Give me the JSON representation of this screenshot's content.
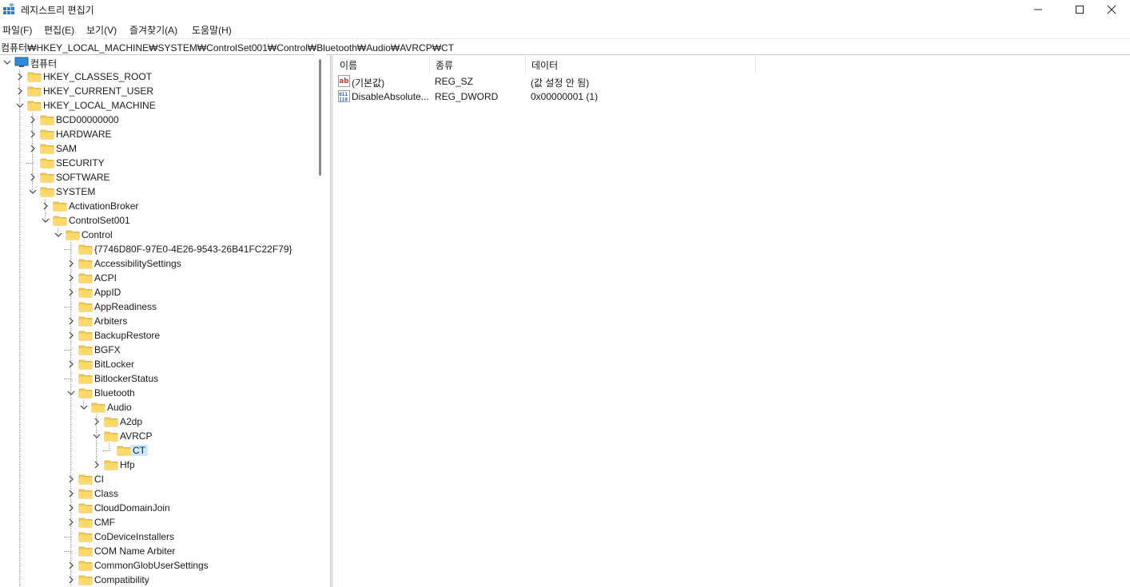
{
  "window": {
    "title": "레지스트리 편집기",
    "icon": "regedit-icon"
  },
  "menu": {
    "file": "파일(F)",
    "edit": "편집(E)",
    "view": "보기(V)",
    "favorites": "즐겨찾기(A)",
    "help": "도움말(H)"
  },
  "address": {
    "path": "컴퓨터₩HKEY_LOCAL_MACHINE₩SYSTEM₩ControlSet001₩Control₩Bluetooth₩Audio₩AVRCP₩CT"
  },
  "tree": {
    "nodes": [
      {
        "label": "컴퓨터",
        "level": 0,
        "state": "expanded",
        "icon": "computer-icon"
      },
      {
        "label": "HKEY_CLASSES_ROOT",
        "level": 1,
        "state": "collapsed"
      },
      {
        "label": "HKEY_CURRENT_USER",
        "level": 1,
        "state": "collapsed"
      },
      {
        "label": "HKEY_LOCAL_MACHINE",
        "level": 1,
        "state": "expanded"
      },
      {
        "label": "BCD00000000",
        "level": 2,
        "state": "collapsed"
      },
      {
        "label": "HARDWARE",
        "level": 2,
        "state": "collapsed"
      },
      {
        "label": "SAM",
        "level": 2,
        "state": "collapsed"
      },
      {
        "label": "SECURITY",
        "level": 2,
        "state": "leaf"
      },
      {
        "label": "SOFTWARE",
        "level": 2,
        "state": "collapsed"
      },
      {
        "label": "SYSTEM",
        "level": 2,
        "state": "expanded"
      },
      {
        "label": "ActivationBroker",
        "level": 3,
        "state": "collapsed"
      },
      {
        "label": "ControlSet001",
        "level": 3,
        "state": "expanded"
      },
      {
        "label": "Control",
        "level": 4,
        "state": "expanded"
      },
      {
        "label": "{7746D80F-97E0-4E26-9543-26B41FC22F79}",
        "level": 5,
        "state": "leaf"
      },
      {
        "label": "AccessibilitySettings",
        "level": 5,
        "state": "collapsed"
      },
      {
        "label": "ACPI",
        "level": 5,
        "state": "collapsed"
      },
      {
        "label": "AppID",
        "level": 5,
        "state": "collapsed"
      },
      {
        "label": "AppReadiness",
        "level": 5,
        "state": "leaf"
      },
      {
        "label": "Arbiters",
        "level": 5,
        "state": "collapsed"
      },
      {
        "label": "BackupRestore",
        "level": 5,
        "state": "collapsed"
      },
      {
        "label": "BGFX",
        "level": 5,
        "state": "leaf"
      },
      {
        "label": "BitLocker",
        "level": 5,
        "state": "collapsed"
      },
      {
        "label": "BitlockerStatus",
        "level": 5,
        "state": "leaf"
      },
      {
        "label": "Bluetooth",
        "level": 5,
        "state": "expanded"
      },
      {
        "label": "Audio",
        "level": 6,
        "state": "expanded"
      },
      {
        "label": "A2dp",
        "level": 7,
        "state": "collapsed"
      },
      {
        "label": "AVRCP",
        "level": 7,
        "state": "expanded"
      },
      {
        "label": "CT",
        "level": 8,
        "state": "leaf",
        "selected": true
      },
      {
        "label": "Hfp",
        "level": 7,
        "state": "collapsed"
      },
      {
        "label": "CI",
        "level": 5,
        "state": "collapsed"
      },
      {
        "label": "Class",
        "level": 5,
        "state": "collapsed"
      },
      {
        "label": "CloudDomainJoin",
        "level": 5,
        "state": "collapsed"
      },
      {
        "label": "CMF",
        "level": 5,
        "state": "collapsed"
      },
      {
        "label": "CoDeviceInstallers",
        "level": 5,
        "state": "leaf"
      },
      {
        "label": "COM Name Arbiter",
        "level": 5,
        "state": "leaf"
      },
      {
        "label": "CommonGlobUserSettings",
        "level": 5,
        "state": "collapsed"
      },
      {
        "label": "Compatibility",
        "level": 5,
        "state": "collapsed"
      }
    ]
  },
  "list": {
    "columns": [
      "이름",
      "종류",
      "데이터"
    ],
    "rows": [
      {
        "name": "(기본값)",
        "type": "REG_SZ",
        "data": "(값 설정 안 됨)",
        "icon": "string-value-icon"
      },
      {
        "name": "DisableAbsolute...",
        "type": "REG_DWORD",
        "data": "0x00000001 (1)",
        "icon": "binary-value-icon"
      }
    ]
  },
  "colors": {
    "folder": "#f6cd57",
    "selection": "#cce8ff",
    "computer": "#2e8bd6"
  }
}
